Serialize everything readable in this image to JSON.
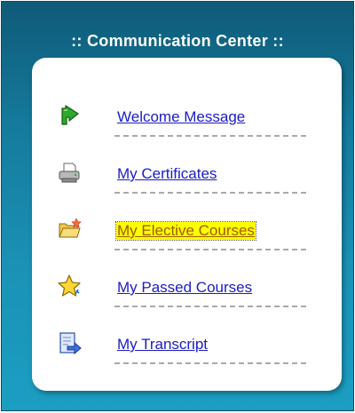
{
  "panel": {
    "title": ":: Communication Center ::"
  },
  "menu": {
    "items": [
      {
        "label": "Welcome Message",
        "icon": "green-arrow-icon",
        "highlighted": false
      },
      {
        "label": "My Certificates",
        "icon": "printer-icon",
        "highlighted": false
      },
      {
        "label": "My Elective Courses",
        "icon": "folder-star-icon",
        "highlighted": true
      },
      {
        "label": "My Passed Courses",
        "icon": "star-icon",
        "highlighted": false
      },
      {
        "label": "My Transcript",
        "icon": "document-arrow-icon",
        "highlighted": false
      }
    ]
  },
  "colors": {
    "panel_background": "#157a9c",
    "link": "#1b1bc6",
    "highlight_background": "#ffff00",
    "highlight_text": "#a05a00"
  }
}
